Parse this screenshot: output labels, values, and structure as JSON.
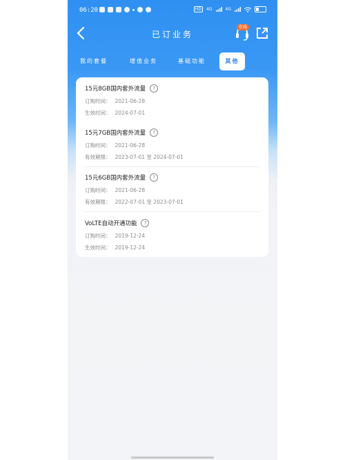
{
  "status_bar": {
    "time": "06:20",
    "network_labels": [
      "HD",
      "4G",
      "4G"
    ]
  },
  "header": {
    "title": "已订业务",
    "back_icon": "chevron-left-icon",
    "service_badge": "在线",
    "service_icon": "customer-service-icon",
    "share_icon": "share-icon"
  },
  "tabs": [
    {
      "label": "我的套餐",
      "active": false
    },
    {
      "label": "增值业务",
      "active": false
    },
    {
      "label": "基础功能",
      "active": false
    },
    {
      "label": "其他",
      "active": true
    }
  ],
  "items": [
    {
      "title": "15元8GB国内套外流量",
      "rows": [
        {
          "label": "订购时间：",
          "value": "2021-06-28"
        },
        {
          "label": "生效时间：",
          "value": "2024-07-01"
        }
      ]
    },
    {
      "title": "15元7GB国内套外流量",
      "rows": [
        {
          "label": "订购时间：",
          "value": "2021-06-28"
        },
        {
          "label": "有效期限：",
          "value": "2023-07-01 至 2024-07-01"
        }
      ]
    },
    {
      "title": "15元6GB国内套外流量",
      "rows": [
        {
          "label": "订购时间：",
          "value": "2021-06-28"
        },
        {
          "label": "有效期限：",
          "value": "2022-07-01 至 2023-07-01"
        }
      ]
    },
    {
      "title": "VoLTE自动开通功能",
      "rows": [
        {
          "label": "订购时间：",
          "value": "2019-12-24"
        },
        {
          "label": "生效时间：",
          "value": "2019-12-24"
        }
      ]
    }
  ],
  "colors": {
    "header_blue": "#2f90f2",
    "active_tab_text": "#2d7fe8",
    "badge_orange": "#ff6b2c"
  }
}
